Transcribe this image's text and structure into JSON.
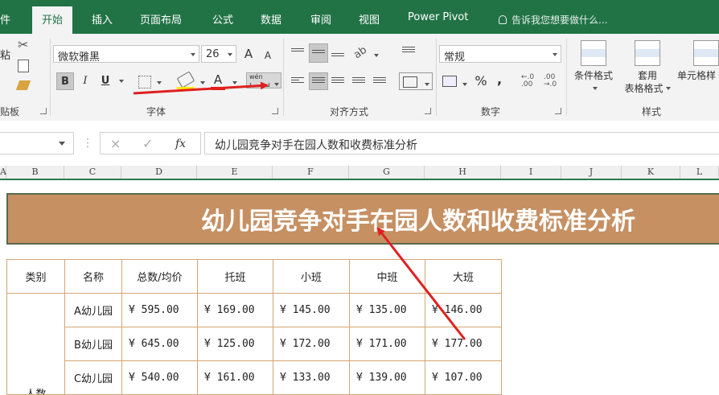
{
  "tabs": [
    {
      "label": "件",
      "active": false
    },
    {
      "label": "开始",
      "active": true
    },
    {
      "label": "插入",
      "active": false
    },
    {
      "label": "页面布局",
      "active": false
    },
    {
      "label": "公式",
      "active": false
    },
    {
      "label": "数据",
      "active": false
    },
    {
      "label": "审阅",
      "active": false
    },
    {
      "label": "视图",
      "active": false
    },
    {
      "label": "Power Pivot",
      "active": false
    }
  ],
  "tell_me": "告诉我您想要做什么...",
  "ribbon": {
    "clipboard": {
      "paste_label": "粘",
      "group_label": "贴板"
    },
    "font": {
      "font_name": "微软雅黑",
      "font_size": "26",
      "grow": "A",
      "shrink": "A",
      "bold": "B",
      "italic": "I",
      "underline": "U",
      "font_color_letter": "A",
      "phonetic_label": "wén",
      "group_label": "字体"
    },
    "alignment": {
      "group_label": "对齐方式"
    },
    "number": {
      "format": "常规",
      "percent": "%",
      "comma": ",",
      "inc_decimal": "←.0 .00",
      "dec_decimal": ".00 →.0",
      "group_label": "数字"
    },
    "styles": {
      "conditional": "条件格式",
      "table_style_line1": "套用",
      "table_style_line2": "表格格式",
      "cell_style": "单元格样",
      "group_label": "样式"
    }
  },
  "formula_bar": {
    "cancel": "×",
    "enter": "✓",
    "fx": "fx",
    "content": "幼儿园竞争对手在园人数和收费标准分析"
  },
  "columns": [
    "A",
    "B",
    "C",
    "D",
    "E",
    "F",
    "G",
    "H",
    "I",
    "J",
    "K",
    "L"
  ],
  "sheet": {
    "title": "幼儿园竞争对手在园人数和收费标准分析",
    "banner_color": "#c69063",
    "border_color": "#d4a574",
    "headers": [
      "类别",
      "名称",
      "总数/均价",
      "托班",
      "小班",
      "中班",
      "大班"
    ],
    "category": "人数",
    "rows": [
      {
        "name": "A幼儿园",
        "total": "¥ 595.00",
        "tuo": "¥ 169.00",
        "xiao": "¥ 145.00",
        "zhong": "¥ 135.00",
        "da": "¥ 146.00"
      },
      {
        "name": "B幼儿园",
        "total": "¥ 645.00",
        "tuo": "¥ 125.00",
        "xiao": "¥ 172.00",
        "zhong": "¥ 171.00",
        "da": "¥ 177.00"
      },
      {
        "name": "C幼儿园",
        "total": "¥ 540.00",
        "tuo": "¥ 161.00",
        "xiao": "¥ 133.00",
        "zhong": "¥ 139.00",
        "da": "¥ 107.00"
      }
    ]
  },
  "annotation_color": "#e02020"
}
